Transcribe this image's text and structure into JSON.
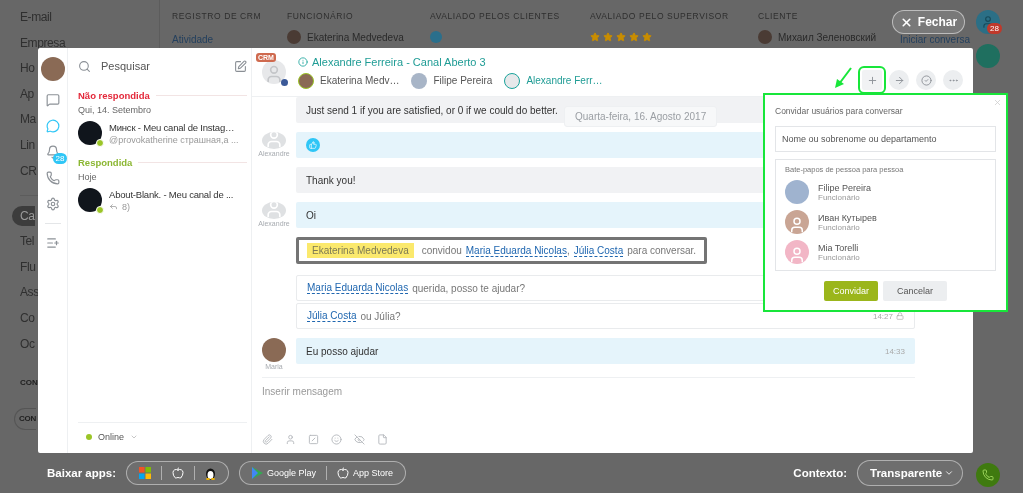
{
  "background": {
    "menu": [
      {
        "label": "E-mail",
        "kind": "item",
        "selected": false
      },
      {
        "label": "Empresa",
        "kind": "item",
        "selected": false
      },
      {
        "label": "Ho",
        "kind": "item",
        "selected": false
      },
      {
        "label": "Ap",
        "kind": "item",
        "selected": false
      },
      {
        "label": "Ma",
        "kind": "item",
        "selected": false
      },
      {
        "label": "Lin",
        "kind": "item",
        "selected": false
      },
      {
        "label": "CR",
        "kind": "item",
        "selected": false
      },
      {
        "label": "Ca",
        "kind": "item",
        "selected": true
      },
      {
        "label": "Tel",
        "kind": "item",
        "selected": false
      },
      {
        "label": "Flu",
        "kind": "item",
        "selected": false
      },
      {
        "label": "Ass",
        "kind": "item",
        "selected": false
      },
      {
        "label": "Co",
        "kind": "item",
        "selected": false
      },
      {
        "label": "Oc",
        "kind": "item",
        "selected": false
      },
      {
        "label": "CON",
        "kind": "section",
        "selected": false
      },
      {
        "label": "CON",
        "kind": "button",
        "selected": false
      }
    ],
    "columns": [
      "REGISTRO DE CRM",
      "FUNCIONÁRIO",
      "AVALIADO PELOS CLIENTES",
      "AVALIADO PELO SUPERVISOR",
      "CLIENTE"
    ],
    "row": {
      "record": "Atividade",
      "employee": "Ekaterina Medvedeva",
      "stars": 5,
      "client": "Михаил Зеленовский",
      "action": "Iniciar conversa"
    }
  },
  "top_actions": {
    "close": "Fechar",
    "notifications_badge": "28"
  },
  "chat_window": {
    "rail": [
      {
        "kind": "chat",
        "selected": false
      },
      {
        "kind": "openlines",
        "selected": true
      },
      {
        "kind": "bell",
        "selected": false,
        "badge": "28"
      },
      {
        "kind": "phone",
        "selected": false
      },
      {
        "kind": "settings",
        "selected": false
      },
      {
        "kind": "addlist",
        "selected": false
      }
    ],
    "recent": {
      "search_placeholder": "Pesquisar",
      "groups": [
        {
          "title": "Não respondida",
          "kind": "unanswered",
          "date": "Qui, 14. Setembro",
          "items": [
            {
              "title": "Минск - Meu canal de Instag…",
              "preview": "@provokatherine страшная,а ...",
              "online": true,
              "replied": false
            }
          ]
        },
        {
          "title": "Respondida",
          "kind": "answered",
          "date": "Hoje",
          "items": [
            {
              "title": "About-Blank. - Meu canal de ...",
              "preview": "8)",
              "online": true,
              "replied": true
            }
          ]
        }
      ],
      "status": "Online"
    },
    "dialog": {
      "crm_badge": "CRM",
      "title": "Alexandre Ferreira - Canal Aberto 3",
      "participants": [
        {
          "name": "Ekaterina Medv…",
          "kind": "operator"
        },
        {
          "name": "Filipe Pereira",
          "kind": "user"
        },
        {
          "name": "Alexandre Ferr…",
          "kind": "client"
        }
      ],
      "actions": [
        {
          "kind": "add",
          "highlighted": true
        },
        {
          "kind": "transfer",
          "highlighted": false
        },
        {
          "kind": "finish",
          "highlighted": false
        },
        {
          "kind": "more",
          "highlighted": false
        }
      ],
      "date_divider": "Quarta-feira, 16. Agosto 2017",
      "messages": [
        {
          "kind": "agent",
          "text": "Just send 1 if you are satisfied, or 0 if we could do better."
        },
        {
          "kind": "client",
          "author": "Alexandre",
          "photo": false,
          "like": true
        },
        {
          "kind": "agent",
          "text": "Thank you!"
        },
        {
          "kind": "client",
          "author": "Alexandre",
          "photo": false,
          "text": "Oi"
        },
        {
          "kind": "invite",
          "inviter": "Ekaterina Medvedeva",
          "verb": "convidou",
          "invitees": [
            "Maria Eduarda Nicolas",
            "Júlia Costa"
          ],
          "separator": ",",
          "suffix": "para conversar.",
          "highlighted": true
        },
        {
          "kind": "mention",
          "mention": "Maria Eduarda Nicolas",
          "text": "querida, posso te ajudar?"
        },
        {
          "kind": "mention",
          "mention": "Júlia Costa",
          "text": "ou Júlia?",
          "time": "14:27",
          "locked": true
        },
        {
          "kind": "client",
          "author": "Maria",
          "photo": true,
          "text": "Eu posso ajudar",
          "time": "14:33"
        }
      ],
      "input_placeholder": "Inserir mensagem"
    }
  },
  "invite_popup": {
    "title": "Convidar usuários para conversar",
    "search_placeholder": "Nome ou sobrenome ou departamento",
    "section": "Bate-papos de pessoa para pessoa",
    "highlighted": true,
    "users": [
      {
        "name": "Filipe Pereira",
        "role": "Funcionário",
        "photo": true,
        "color": "#9fb3cf"
      },
      {
        "name": "Иван Кутырев",
        "role": "Funcionário",
        "photo": false,
        "color": "#c9a594"
      },
      {
        "name": "Mia Torelli",
        "role": "Funcionário",
        "photo": false,
        "color": "#f2b6c6"
      }
    ],
    "buttons": [
      {
        "label": "Convidar",
        "kind": "primary"
      },
      {
        "label": "Cancelar",
        "kind": "secondary"
      }
    ]
  },
  "bottom_bar": {
    "label": "Baixar apps:",
    "desktop": [
      {
        "kind": "windows"
      },
      {
        "kind": "apple"
      },
      {
        "kind": "linux"
      }
    ],
    "stores": [
      {
        "kind": "google",
        "label": "Google Play"
      },
      {
        "kind": "apple",
        "label": "App Store"
      }
    ],
    "context_label": "Contexto:",
    "context_value": "Transparente"
  }
}
